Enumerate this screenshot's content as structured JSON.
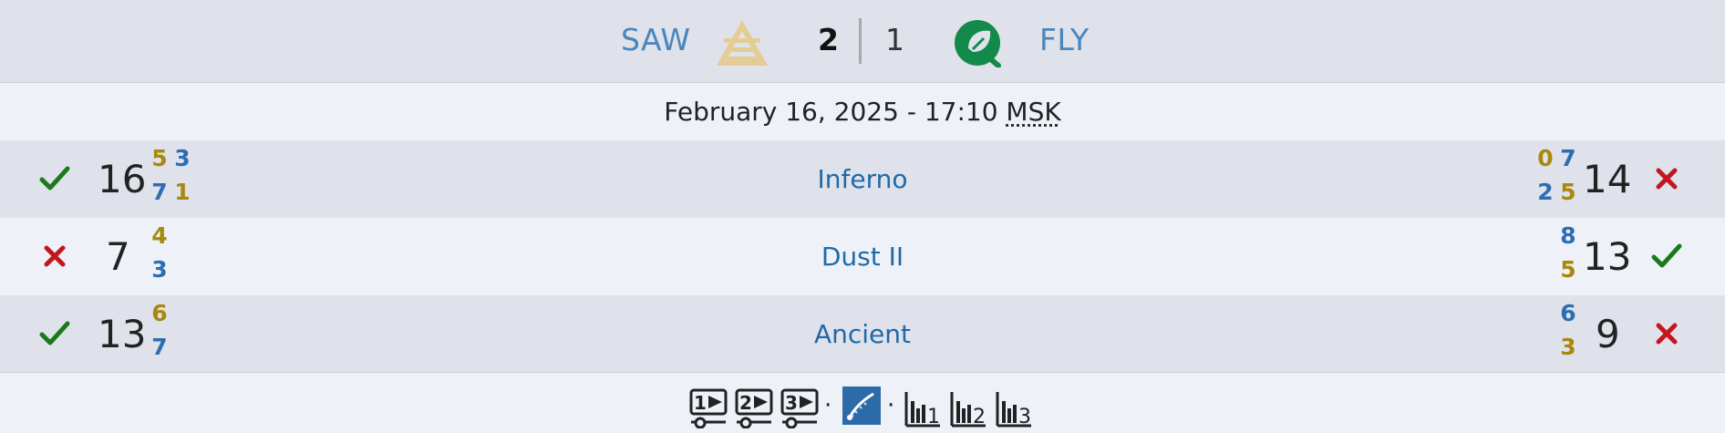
{
  "match": {
    "team_left": {
      "name": "SAW",
      "score": "2",
      "logo": "saw-logo"
    },
    "team_right": {
      "name": "FLY",
      "score": "1",
      "logo": "fly-logo"
    },
    "date": "February 16, 2025 - 17:10 ",
    "timezone": "MSK"
  },
  "maps": [
    {
      "name": "Inferno",
      "left": {
        "result": "win",
        "score": "16",
        "halves_col1": [
          "5",
          "7"
        ],
        "halves_col2": [
          "3",
          "1"
        ]
      },
      "right": {
        "result": "loss",
        "score": "14",
        "halves_col1": [
          "0",
          "2"
        ],
        "halves_col2": [
          "7",
          "5"
        ]
      }
    },
    {
      "name": "Dust II",
      "left": {
        "result": "loss",
        "score": "7",
        "halves_col1": [
          "4",
          "3"
        ]
      },
      "right": {
        "result": "win",
        "score": "13",
        "halves_col1": [
          "8",
          "5"
        ]
      }
    },
    {
      "name": "Ancient",
      "left": {
        "result": "win",
        "score": "13",
        "halves_col1": [
          "6",
          "7"
        ]
      },
      "right": {
        "result": "loss",
        "score": "9",
        "halves_col1": [
          "6",
          "3"
        ]
      }
    }
  ],
  "footer": {
    "vod_labels": [
      "1",
      "2",
      "3"
    ],
    "stats_labels": [
      "1",
      "2",
      "3"
    ],
    "separator": "·",
    "icons": [
      "vod-1-icon",
      "vod-2-icon",
      "vod-3-icon",
      "hltv-stats-icon",
      "stats-map-1-icon",
      "stats-map-2-icon",
      "stats-map-3-icon"
    ]
  },
  "colors": {
    "win": "#1a7a1a",
    "loss": "#c4161c",
    "half_gold": "#a8890e",
    "half_blue": "#2c6db3",
    "team_name": "#4a86bd",
    "map_link": "#1e6aa8"
  }
}
